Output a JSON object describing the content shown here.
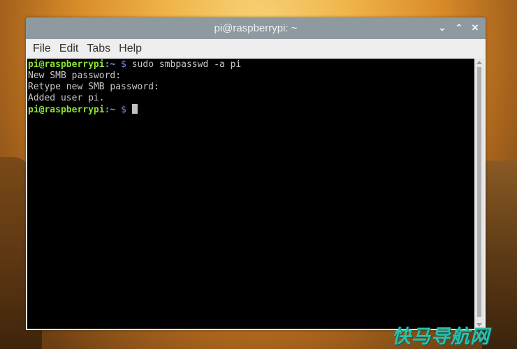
{
  "window": {
    "title": "pi@raspberrypi: ~",
    "controls": {
      "minimize": "⌄",
      "maximize": "⌃",
      "close": "✕"
    }
  },
  "menu": {
    "items": [
      "File",
      "Edit",
      "Tabs",
      "Help"
    ]
  },
  "terminal": {
    "lines": [
      {
        "user": "pi@raspberrypi",
        "path": ":~",
        "sign": " $",
        "text": " sudo smbpasswd -a pi"
      },
      {
        "text": "New SMB password:"
      },
      {
        "text": "Retype new SMB password:"
      },
      {
        "text": "Added user pi."
      },
      {
        "user": "pi@raspberrypi",
        "path": ":~",
        "sign": " $",
        "text": " "
      }
    ]
  },
  "watermark": "快马导航网"
}
